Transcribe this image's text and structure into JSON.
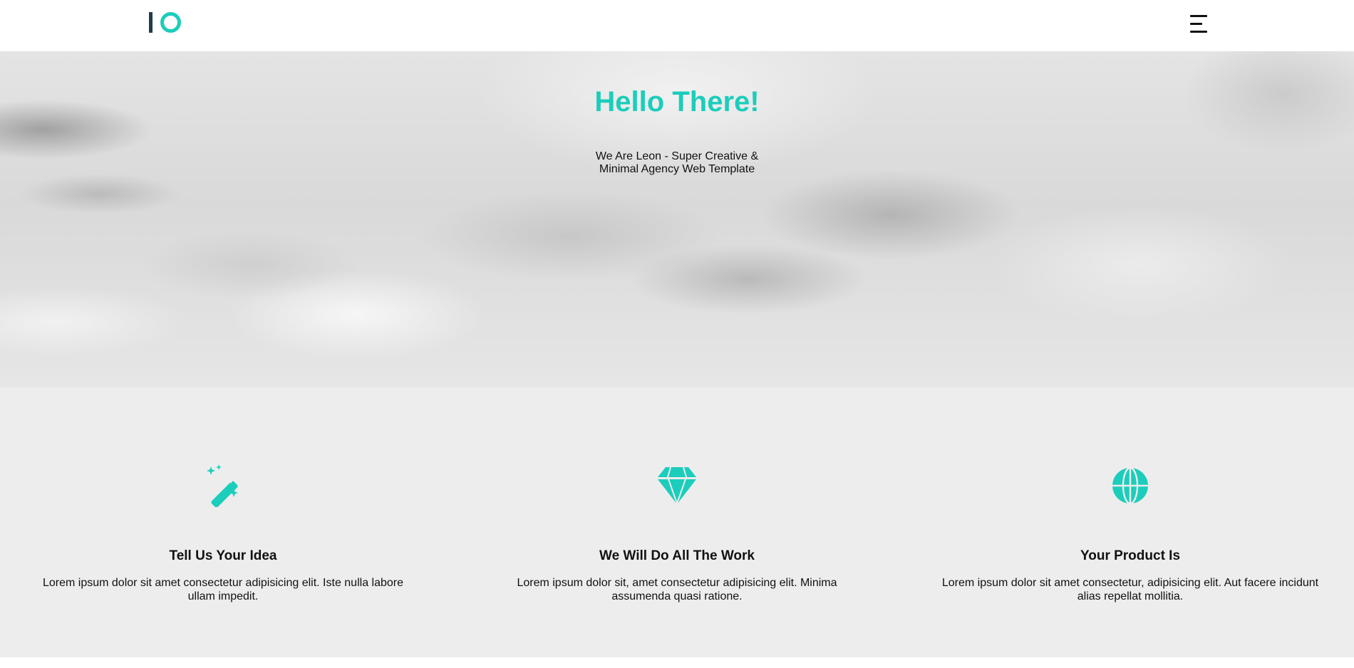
{
  "brand": {
    "logo_name": "logo-io",
    "accent_color": "#1ccdbb",
    "dark_color": "#1f3d4a"
  },
  "header": {
    "menu_icon": "hamburger-menu-icon"
  },
  "hero": {
    "title": "Hello There!",
    "subtitle_line1": "We Are Leon - Super Creative &",
    "subtitle_line2": "Minimal Agency Web Template"
  },
  "features": [
    {
      "icon": "magic-wand-icon",
      "title": "Tell Us Your Idea",
      "text": "Lorem ipsum dolor sit amet consectetur adipisicing elit. Iste nulla labore ullam impedit."
    },
    {
      "icon": "diamond-icon",
      "title": "We Will Do All The Work",
      "text": "Lorem ipsum dolor sit, amet consectetur adipisicing elit. Minima assumenda quasi ratione."
    },
    {
      "icon": "globe-icon",
      "title": "Your Product Is",
      "text": "Lorem ipsum dolor sit amet consectetur, adipisicing elit. Aut facere incidunt alias repellat mollitia."
    }
  ]
}
